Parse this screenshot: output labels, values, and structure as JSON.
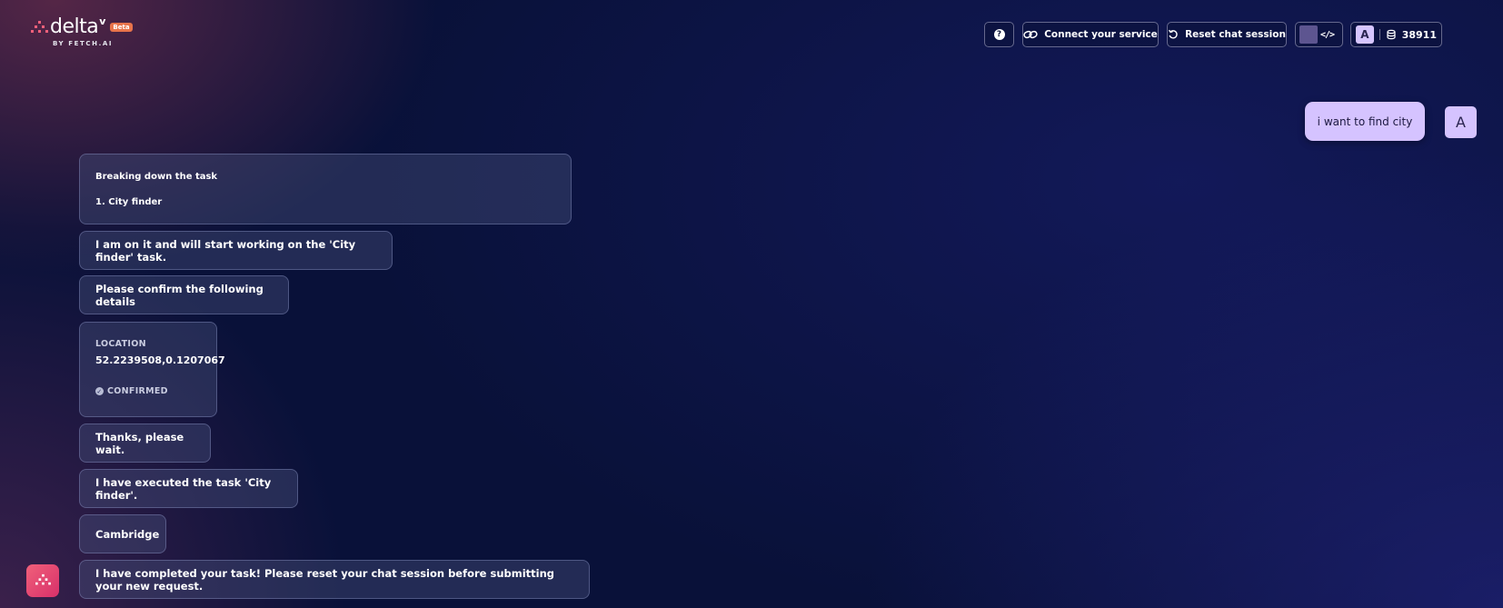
{
  "logo": {
    "word": "delta",
    "superscript": "v",
    "badge": "Beta",
    "byline": "BY FETCH.AI"
  },
  "header": {
    "help_icon": "question-circle-icon",
    "connect_label": "Connect your service",
    "connect_icon": "link-icon",
    "reset_label": "Reset chat session",
    "reset_icon": "reset-arrow-icon",
    "dev_icon": "code-icon",
    "dev_swatch_color": "#5d5590",
    "user_initial": "A",
    "credits_icon": "coins-stack-icon",
    "credits": "38911"
  },
  "chat": {
    "user_message": "i want to find city",
    "user_avatar": "A",
    "breakdown": {
      "title": "Breaking down the task",
      "item": "1. City finder"
    },
    "on_it": "I am on it and will start working on the 'City finder' task.",
    "confirm_prompt": "Please confirm the following details",
    "location": {
      "label": "LOCATION",
      "value": "52.2239508,0.1207067",
      "status": "CONFIRMED"
    },
    "wait": "Thanks, please wait.",
    "executed": "I have executed the task 'City finder'.",
    "result": "Cambridge",
    "completed": "I have completed your task! Please reset your chat session before submitting your new request."
  },
  "colors": {
    "background": "#091139",
    "user_bubble": "#d5c3ff",
    "beta_badge": "#e8744b",
    "fab": "#e24a70"
  }
}
